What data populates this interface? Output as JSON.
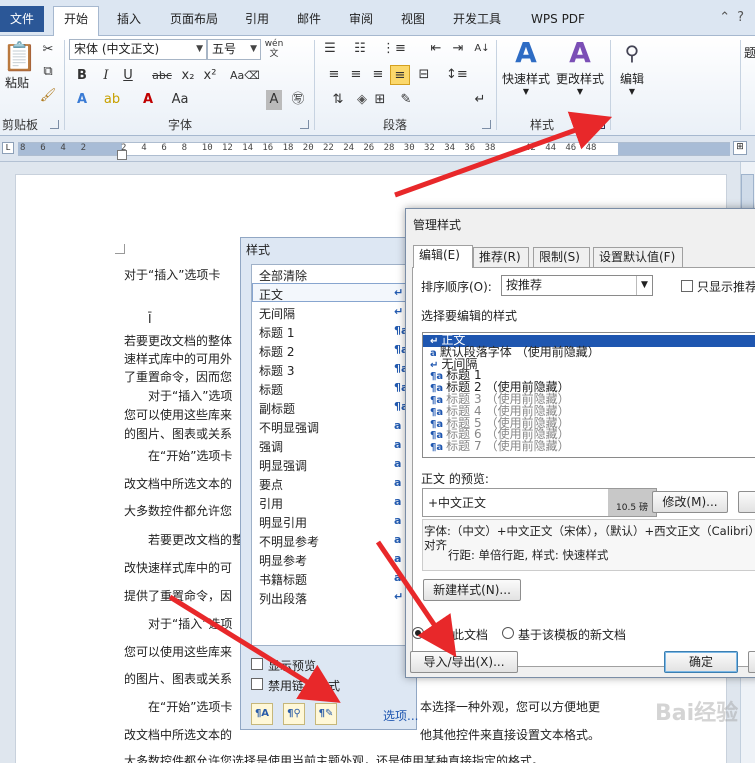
{
  "tabs": [
    {
      "label": "文件"
    },
    {
      "label": "开始"
    },
    {
      "label": "插入"
    },
    {
      "label": "页面布局"
    },
    {
      "label": "引用"
    },
    {
      "label": "邮件"
    },
    {
      "label": "审阅"
    },
    {
      "label": "视图"
    },
    {
      "label": "开发工具"
    },
    {
      "label": "WPS PDF"
    }
  ],
  "ribbon": {
    "paste_label": "粘贴",
    "clipboard_label": "剪贴板",
    "font_name": "宋体 (中文正文)",
    "font_size": "五号",
    "font_label": "字体",
    "paragraph_label": "段落",
    "quick_styles_label": "快速样式",
    "change_styles_label": "更改样式",
    "styles_group_label": "样式",
    "edit_label": "编辑",
    "edit_side": "题"
  },
  "ruler_ticks": [
    "8",
    "6",
    "4",
    "2",
    "",
    "2",
    "4",
    "6",
    "8",
    "10",
    "12",
    "14",
    "16",
    "18",
    "20",
    "22",
    "24",
    "26",
    "28",
    "30",
    "32",
    "34",
    "36",
    "38",
    "",
    "42",
    "44",
    "46",
    "48"
  ],
  "document": {
    "lines": [
      "对于“插入”选项卡",
      "Ī",
      "若要更改文档的整体",
      "速样式库中的可用外",
      "了重置命令，因而您",
      "对于“插入”选项",
      "您可以使用这些库来",
      "的图片、图表或关系",
      "在“开始”选项卡",
      "改文档中所选文本的",
      "大多数控件都允许您",
      "若要更改文档的整",
      "改快速样式库中的可",
      "提供了重置命令，因",
      "对于“插入”选项",
      "您可以使用这些库来",
      "的图片、图表或关系",
      "在“开始”选项卡",
      "改文档中所选文本的",
      "大多数控件都允许您选择是使用当前主题外观，还是使用某种直接指定的格式。"
    ],
    "line_tail_1": "本选择一种外观，您可以方便地更",
    "line_tail_2": "他其他控件来直接设置文本格式。"
  },
  "styles_pane": {
    "title": "样式",
    "items": [
      "全部清除",
      "正文",
      "无间隔",
      "标题 1",
      "标题 2",
      "标题 3",
      "标题",
      "副标题",
      "不明显强调",
      "强调",
      "明显强调",
      "要点",
      "引用",
      "明显引用",
      "不明显参考",
      "明显参考",
      "书籍标题",
      "列出段落"
    ],
    "marks": [
      "",
      "↵",
      "↵",
      "¶a",
      "¶a",
      "¶a",
      "¶a",
      "¶a",
      "a",
      "a",
      "a",
      "a",
      "a",
      "a",
      "a",
      "a",
      "a",
      "↵"
    ],
    "show_preview": "显示预览",
    "disable_linked": "禁用链接样式",
    "options_link": "选项..."
  },
  "manage_dialog": {
    "title": "管理样式",
    "tabs": [
      "编辑(E)",
      "推荐(R)",
      "限制(S)",
      "设置默认值(F)"
    ],
    "sort_label": "排序顺序(O):",
    "sort_value": "按推荐",
    "only_recommended": "只显示推荐",
    "select_label": "选择要编辑的样式",
    "list": [
      {
        "icon": "↵",
        "name": "正文",
        "hint": "",
        "selected": true,
        "gray": false
      },
      {
        "icon": "a",
        "name": "默认段落字体",
        "hint": "（使用前隐藏）",
        "selected": false,
        "gray": false
      },
      {
        "icon": "↵",
        "name": "无间隔",
        "hint": "",
        "selected": false,
        "gray": false
      },
      {
        "icon": "¶a",
        "name": "标题 1",
        "hint": "",
        "selected": false,
        "gray": false
      },
      {
        "icon": "¶a",
        "name": "标题 2",
        "hint": "（使用前隐藏）",
        "selected": false,
        "gray": false
      },
      {
        "icon": "¶a",
        "name": "标题 3",
        "hint": "（使用前隐藏）",
        "selected": false,
        "gray": true
      },
      {
        "icon": "¶a",
        "name": "标题 4",
        "hint": "（使用前隐藏）",
        "selected": false,
        "gray": true
      },
      {
        "icon": "¶a",
        "name": "标题 5",
        "hint": "（使用前隐藏）",
        "selected": false,
        "gray": true
      },
      {
        "icon": "¶a",
        "name": "标题 6",
        "hint": "（使用前隐藏）",
        "selected": false,
        "gray": true
      },
      {
        "icon": "¶a",
        "name": "标题 7",
        "hint": "（使用前隐藏）",
        "selected": false,
        "gray": true
      }
    ],
    "preview_label": "正文 的预览:",
    "preview_text": "+中文正文",
    "preview_size": "10.5 磅",
    "modify_button": "修改(M)...",
    "desc_line1": "字体:（中文）+中文正文（宋体），（默认）+西文正文（Calibri）",
    "desc_line2": "对齐",
    "desc_line3": "行距: 单倍行距, 样式: 快速样式",
    "new_style_button": "新建样式(N)...",
    "radio_only_doc": "仅限此文档",
    "radio_template": "基于该模板的新文档",
    "import_export_button": "导入/导出(X)...",
    "ok_button": "确定"
  },
  "colors": {
    "arrow": "#e8282a",
    "file_tab": "#2b5797",
    "selection": "#1e56b0"
  },
  "watermark": "Bai经验"
}
